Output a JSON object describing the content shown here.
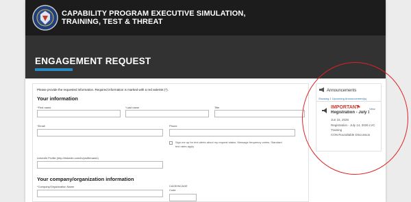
{
  "header": {
    "brand_line1": "CAPABILITY PROGRAM EXECUTIVE SIMULATION,",
    "brand_line2": "TRAINING, TEST & THREAT",
    "logo": "seal-icon"
  },
  "banner": {
    "title": "ENGAGEMENT REQUEST",
    "accent": "#2a8cc7"
  },
  "form": {
    "intro": "Please provide the requested information. Required information is marked with a red asterisk (*).",
    "your_info_title": "Your information",
    "first_name_label": "First name",
    "last_name_label": "Last name",
    "title_label": "Title",
    "email_label": "Email",
    "phone_label": "Phone",
    "sms_line1": "Sign me up for text alerts about my request status. Message frequency varies. Standard",
    "sms_line2": "text rates apply",
    "linkedin_label": "LinkedIn Profile (http://linkedin.com/in/profilename)",
    "company_title": "Your company/organization information",
    "company_label": "Company/Organization Name",
    "cage_label1": "CAGE/NCAGE",
    "cage_label2": "Code",
    "required_mark": "*"
  },
  "announcements": {
    "heading": "Announcements",
    "count": "Showing 1 Upcoming Announcement(s)",
    "item": {
      "badge": "IMPORTANT",
      "title": "Registration - July 14, 20:",
      "view": "View",
      "date": "Jun 15, 2026",
      "desc_line1": "Registration - July 14, 2026 LVC Training",
      "desc_line2": "CON Roundtable Discussion"
    },
    "highlight_color": "#e02222"
  }
}
